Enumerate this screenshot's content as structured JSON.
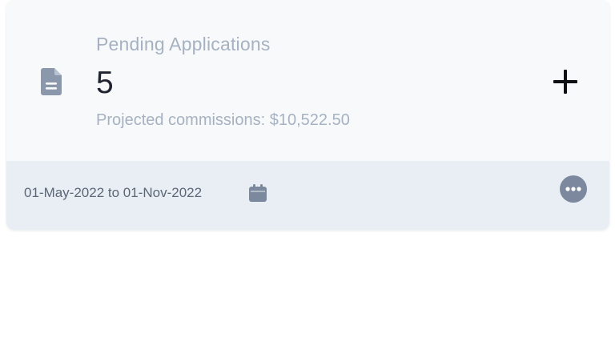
{
  "card": {
    "title": "Pending Applications",
    "count": "5",
    "subtitle": "Projected commissions: $10,522.50",
    "add_icon": "plus-icon",
    "doc_icon": "document-icon"
  },
  "footer": {
    "date_range": "01-May-2022 to 01-Nov-2022",
    "calendar_icon": "calendar-icon",
    "more_icon": "more-horizontal-icon"
  },
  "colors": {
    "card_bg": "#f7f9fb",
    "footer_bg": "#e9eef4",
    "muted_text": "#a6b2c2",
    "icon_slate": "#7b889d",
    "count_text": "#1f2430"
  }
}
